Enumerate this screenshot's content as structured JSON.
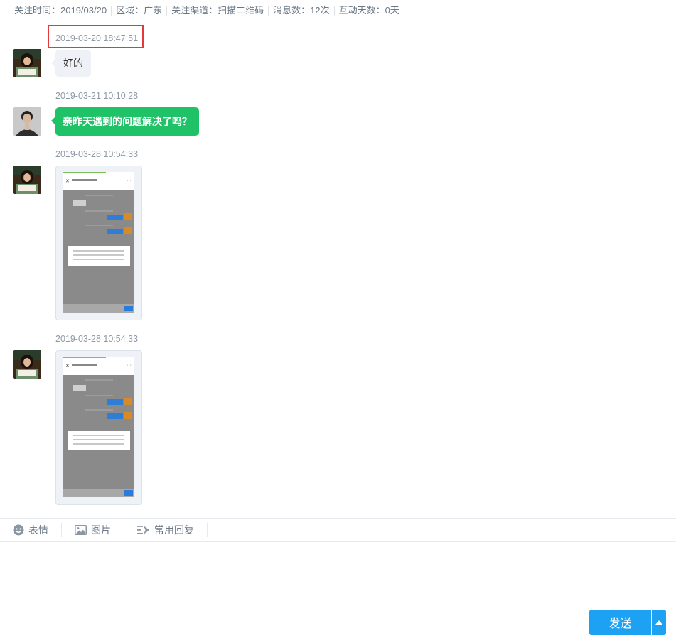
{
  "info_bar": {
    "follow_time": "关注时间：2019/03/20",
    "region": "区域：广东",
    "channel": "关注渠道：扫描二维码",
    "message_count": "消息数：12次",
    "interaction_days": "互动天数：0天"
  },
  "messages": [
    {
      "timestamp": "2019-03-20 18:47:51",
      "sender": "user",
      "type": "text",
      "text": "好的",
      "highlighted": true
    },
    {
      "timestamp": "2019-03-21 10:10:28",
      "sender": "agent",
      "type": "text",
      "text": "亲昨天遇到的问题解决了吗？"
    },
    {
      "timestamp": "2019-03-28 10:54:33",
      "sender": "user",
      "type": "image"
    },
    {
      "timestamp": "2019-03-28 10:54:33",
      "sender": "user",
      "type": "image"
    }
  ],
  "toolbar": {
    "emoji_label": "表情",
    "image_label": "图片",
    "quick_reply_label": "常用回复"
  },
  "compose": {
    "placeholder": ""
  },
  "send": {
    "label": "发送"
  },
  "colors": {
    "accent_blue": "#1da1f2",
    "agent_bubble": "#1fc267",
    "user_bubble": "#eef2f7",
    "highlight_box": "#e4393c"
  }
}
